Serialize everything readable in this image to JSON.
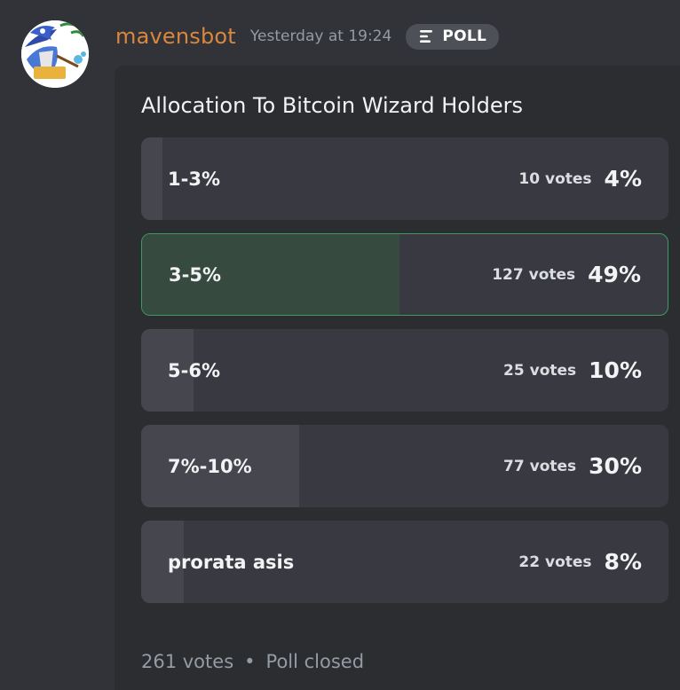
{
  "author": {
    "username": "mavensbot",
    "timestamp": "Yesterday at 19:24",
    "avatar_icon": "wizard-avatar-icon"
  },
  "badge": {
    "label": "POLL",
    "icon": "poll-bars-icon"
  },
  "poll": {
    "question": "Allocation To Bitcoin Wizard Holders",
    "answers": [
      {
        "label": "1-3%",
        "votes": "10 votes",
        "percent": "4%",
        "fraction": 0.04,
        "winner": false
      },
      {
        "label": "3-5%",
        "votes": "127 votes",
        "percent": "49%",
        "fraction": 0.49,
        "winner": true
      },
      {
        "label": "5-6%",
        "votes": "25 votes",
        "percent": "10%",
        "fraction": 0.1,
        "winner": false
      },
      {
        "label": "7%-10%",
        "votes": "77 votes",
        "percent": "30%",
        "fraction": 0.3,
        "winner": false
      },
      {
        "label": "prorata asis",
        "votes": "22 votes",
        "percent": "8%",
        "fraction": 0.08,
        "winner": false
      }
    ],
    "total_votes": "261 votes",
    "separator": "•",
    "status": "Poll closed"
  },
  "colors": {
    "username": "#d9873c",
    "winner_border": "#3c9b5e",
    "winner_fill": "#364a3f",
    "fill": "#45464e",
    "answer_bg": "#393a41"
  }
}
